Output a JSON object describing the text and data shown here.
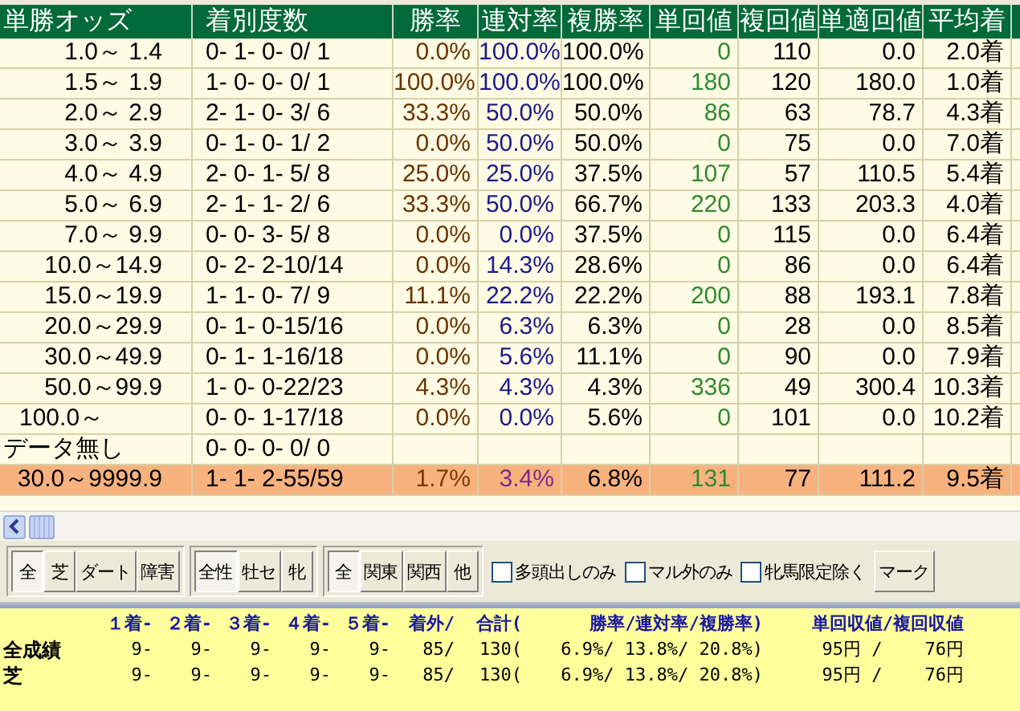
{
  "table": {
    "columns": [
      "単勝オッズ",
      "着別度数",
      "勝率",
      "連対率",
      "複勝率",
      "単回値",
      "複回値",
      "単適回値",
      "平均着"
    ],
    "rows": [
      {
        "kind": "range",
        "highlighted": false,
        "cells": [
          "1.0～ 1.4",
          "0- 1- 0- 0/ 1",
          "0.0%",
          "100.0%",
          "100.0%",
          "0",
          "110",
          "0.0",
          "2.0着"
        ]
      },
      {
        "kind": "range",
        "highlighted": false,
        "cells": [
          "1.5～ 1.9",
          "1- 0- 0- 0/ 1",
          "100.0%",
          "100.0%",
          "100.0%",
          "180",
          "120",
          "180.0",
          "1.0着"
        ]
      },
      {
        "kind": "range",
        "highlighted": false,
        "cells": [
          "2.0～ 2.9",
          "2- 1- 0- 3/ 6",
          "33.3%",
          "50.0%",
          "50.0%",
          "86",
          "63",
          "78.7",
          "4.3着"
        ]
      },
      {
        "kind": "range",
        "highlighted": false,
        "cells": [
          "3.0～ 3.9",
          "0- 1- 0- 1/ 2",
          "0.0%",
          "50.0%",
          "50.0%",
          "0",
          "75",
          "0.0",
          "7.0着"
        ]
      },
      {
        "kind": "range",
        "highlighted": false,
        "cells": [
          "4.0～ 4.9",
          "2- 0- 1- 5/ 8",
          "25.0%",
          "25.0%",
          "37.5%",
          "107",
          "57",
          "110.5",
          "5.4着"
        ]
      },
      {
        "kind": "range",
        "highlighted": false,
        "cells": [
          "5.0～ 6.9",
          "2- 1- 1- 2/ 6",
          "33.3%",
          "50.0%",
          "66.7%",
          "220",
          "133",
          "203.3",
          "4.0着"
        ]
      },
      {
        "kind": "range",
        "highlighted": false,
        "cells": [
          "7.0～ 9.9",
          "0- 0- 3- 5/ 8",
          "0.0%",
          "0.0%",
          "37.5%",
          "0",
          "115",
          "0.0",
          "6.4着"
        ]
      },
      {
        "kind": "range",
        "highlighted": false,
        "cells": [
          "10.0～14.9",
          "0- 2- 2-10/14",
          "0.0%",
          "14.3%",
          "28.6%",
          "0",
          "86",
          "0.0",
          "6.4着"
        ]
      },
      {
        "kind": "range",
        "highlighted": false,
        "cells": [
          "15.0～19.9",
          "1- 1- 0- 7/ 9",
          "11.1%",
          "22.2%",
          "22.2%",
          "200",
          "88",
          "193.1",
          "7.8着"
        ]
      },
      {
        "kind": "range",
        "highlighted": false,
        "cells": [
          "20.0～29.9",
          "0- 1- 0-15/16",
          "0.0%",
          "6.3%",
          "6.3%",
          "0",
          "28",
          "0.0",
          "8.5着"
        ]
      },
      {
        "kind": "range",
        "highlighted": false,
        "cells": [
          "30.0～49.9",
          "0- 1- 1-16/18",
          "0.0%",
          "5.6%",
          "11.1%",
          "0",
          "90",
          "0.0",
          "7.9着"
        ]
      },
      {
        "kind": "range",
        "highlighted": false,
        "cells": [
          "50.0～99.9",
          "1- 0- 0-22/23",
          "4.3%",
          "4.3%",
          "4.3%",
          "336",
          "49",
          "300.4",
          "10.3着"
        ]
      },
      {
        "kind": "open",
        "highlighted": false,
        "cells": [
          "100.0～",
          "0- 0- 1-17/18",
          "0.0%",
          "0.0%",
          "5.6%",
          "0",
          "101",
          "0.0",
          "10.2着"
        ]
      },
      {
        "kind": "no_data",
        "highlighted": false,
        "cells": [
          "データ無し",
          "0- 0- 0- 0/ 0",
          "",
          "",
          "",
          "",
          "",
          "",
          ""
        ]
      },
      {
        "kind": "range",
        "highlighted": true,
        "cells": [
          "30.0～9999.9",
          "1- 1- 2-55/59",
          "1.7%",
          "3.4%",
          "6.8%",
          "131",
          "77",
          "111.2",
          "9.5着"
        ]
      }
    ]
  },
  "filters": {
    "groups": [
      [
        {
          "label": "全",
          "selected": true
        },
        {
          "label": "芝",
          "selected": false
        },
        {
          "label": "ダート",
          "selected": false
        },
        {
          "label": "障害",
          "selected": false
        }
      ],
      [
        {
          "label": "全性",
          "selected": true
        },
        {
          "label": "牡セ",
          "selected": false
        },
        {
          "label": "牝",
          "selected": false
        }
      ],
      [
        {
          "label": "全",
          "selected": true
        },
        {
          "label": "関東",
          "selected": false
        },
        {
          "label": "関西",
          "selected": false
        },
        {
          "label": "他",
          "selected": false
        }
      ]
    ],
    "checkboxes": [
      {
        "label": "多頭出しのみ",
        "checked": false
      },
      {
        "label": "マル外のみ",
        "checked": false
      },
      {
        "label": "牝馬限定除く",
        "checked": false
      }
    ],
    "mark_button": "マーク"
  },
  "summary": {
    "headers": [
      "１着-",
      "２着-",
      "３着-",
      "４着-",
      "５着-",
      "着外/",
      "合計(",
      "勝率/連対率/複勝率)",
      "単回収値/複回収値"
    ],
    "rows": [
      {
        "label": "全成績",
        "cells": [
          "9-",
          "9-",
          "9-",
          "9-",
          "9-",
          "85/",
          "130(",
          "6.9%/ 13.8%/ 20.8%)",
          "95円 /    76円"
        ]
      },
      {
        "label": "芝",
        "cells": [
          "9-",
          "9-",
          "9-",
          "9-",
          "9-",
          "85/",
          "130(",
          "6.9%/ 13.8%/ 20.8%)",
          "95円 /    76円"
        ]
      }
    ]
  }
}
